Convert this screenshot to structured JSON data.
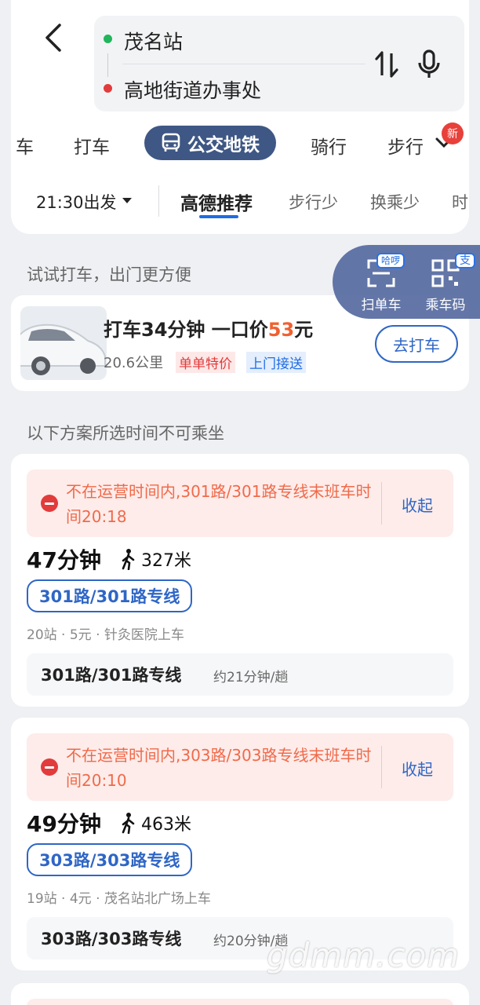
{
  "route": {
    "from": "茂名站",
    "to": "高地街道办事处"
  },
  "modes": {
    "partial_left": "车",
    "taxi": "打车",
    "transit": "公交地铁",
    "bike": "骑行",
    "walk_partial": "步行",
    "new_badge": "新"
  },
  "options": {
    "depart": "21:30出发",
    "recommended": "高德推荐",
    "less_walk": "步行少",
    "less_transfer": "换乘少",
    "time_partial": "时"
  },
  "float_panel": {
    "scan_label": "扫单车",
    "scan_tag": "哈啰",
    "code_label": "乘车码",
    "code_tag": "支"
  },
  "taxi_section": {
    "title": "试试打车，出门更方便",
    "card": {
      "title_prefix": "打车34分钟 一口价",
      "price": "53",
      "unit": "元",
      "distance": "20.6公里",
      "tag_special": "单单特价",
      "tag_pickup": "上门接送",
      "button": "去打车"
    }
  },
  "unavailable_title": "以下方案所选时间不可乘坐",
  "plans": [
    {
      "warning": "不在运营时间内,301路/301路专线末班车时间20:18",
      "collapse": "收起",
      "duration": "47分钟",
      "walk": "327米",
      "line_chip": "301路/301路专线",
      "meta": "20站 · 5元 · 针灸医院上车",
      "line_name": "301路/301路专线",
      "frequency": "约21分钟/趟"
    },
    {
      "warning": "不在运营时间内,303路/303路专线末班车时间20:10",
      "collapse": "收起",
      "duration": "49分钟",
      "walk": "463米",
      "line_chip": "303路/303路专线",
      "meta": "19站 · 4元 · 茂名站北广场上车",
      "line_name": "303路/303路专线",
      "frequency": "约20分钟/趟"
    }
  ],
  "watermark": "gdmm.com",
  "colors": {
    "accent_blue": "#2f66c6",
    "active_tab": "#3f5784",
    "warning": "#f06a4a",
    "price": "#f06030"
  }
}
